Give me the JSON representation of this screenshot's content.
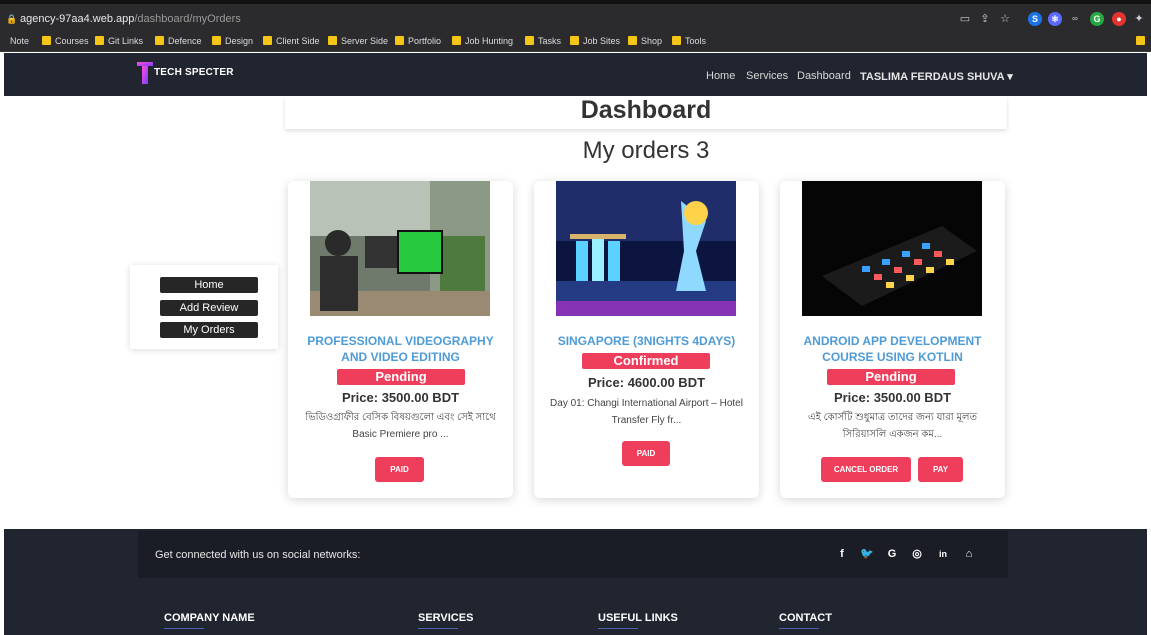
{
  "browser": {
    "url_host": "agency-97aa4.web.app",
    "url_path": "/dashboard/myOrders",
    "bookmarks": [
      "Note",
      "Courses",
      "Git Links",
      "Defence",
      "Design",
      "Client Side",
      "Server Side",
      "Portfolio",
      "Job Hunting",
      "Tasks",
      "Job Sites",
      "Shop",
      "Tools"
    ]
  },
  "navbar": {
    "brand": "TECH SPECTER",
    "links": [
      "Home",
      "Services",
      "Dashboard"
    ],
    "user": "TASLIMA FERDAUS SHUVA ▾"
  },
  "main": {
    "title": "Dashboard",
    "subtitle": "My orders 3"
  },
  "side_menu": [
    "Home",
    "Add Review",
    "My Orders"
  ],
  "orders": [
    {
      "title": "PROFESSIONAL VIDEOGRAPHY AND VIDEO EDITING",
      "status": "Pending",
      "price": "Price: 3500.00 BDT",
      "description": "ভিডিওগ্রাফীর বেসিক বিষয়গুলো এবং সেই সাথে Basic Premiere pro ...",
      "buttons": [
        "PAID"
      ]
    },
    {
      "title": "SINGAPORE (3NIGHTS 4DAYS)",
      "status": "Confirmed",
      "price": "Price: 4600.00 BDT",
      "description": "Day 01: Changi International Airport – Hotel Transfer Fly fr...",
      "buttons": [
        "PAID"
      ]
    },
    {
      "title": "ANDROID APP DEVELOPMENT COURSE USING KOTLIN",
      "status": "Pending",
      "price": "Price: 3500.00 BDT",
      "description": "এই কোর্সটি শুধুমাত্র তাদের জন্য যারা মূলত সিরিয়াসলি একজন কম...",
      "buttons": [
        "CANCEL ORDER",
        "PAY"
      ]
    }
  ],
  "footer": {
    "social_text": "Get connected with us on social networks:",
    "social_icons": [
      "f",
      "🐦",
      "G",
      "◎",
      "in",
      "⌂"
    ],
    "headings": [
      "COMPANY NAME",
      "SERVICES",
      "USEFUL LINKS",
      "CONTACT"
    ]
  },
  "colors": {
    "accent_red": "#ee3e5c",
    "title_blue": "#4e9bd6",
    "navbar_bg": "#212530"
  }
}
